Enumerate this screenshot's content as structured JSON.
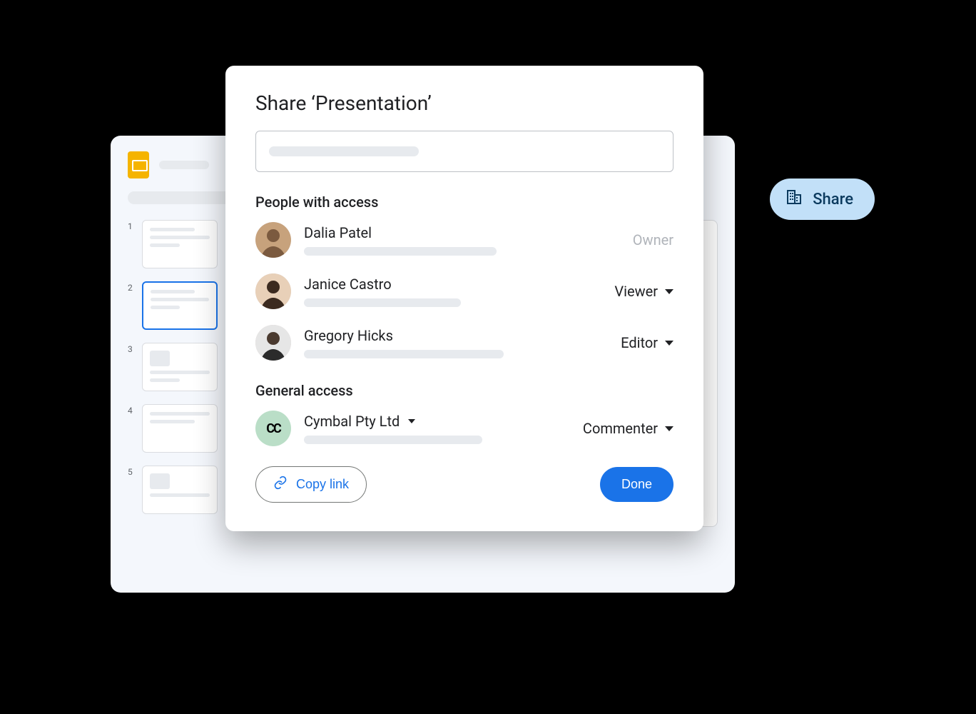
{
  "slides": {
    "thumbnails": [
      {
        "num": "1",
        "selected": false
      },
      {
        "num": "2",
        "selected": true
      },
      {
        "num": "3",
        "selected": false
      },
      {
        "num": "4",
        "selected": false
      },
      {
        "num": "5",
        "selected": false
      }
    ]
  },
  "sharePill": {
    "label": "Share"
  },
  "dialog": {
    "title": "Share ‘Presentation’",
    "peopleHeading": "People with access",
    "generalHeading": "General access",
    "people": [
      {
        "name": "Dalia Patel",
        "role": "Owner",
        "roleDropdown": false
      },
      {
        "name": "Janice Castro",
        "role": "Viewer",
        "roleDropdown": true
      },
      {
        "name": "Gregory Hicks",
        "role": "Editor",
        "roleDropdown": true
      }
    ],
    "general": {
      "orgName": "Cymbal Pty Ltd",
      "orgIcon": "CC",
      "role": "Commenter"
    },
    "copyLinkLabel": "Copy link",
    "doneLabel": "Done"
  }
}
